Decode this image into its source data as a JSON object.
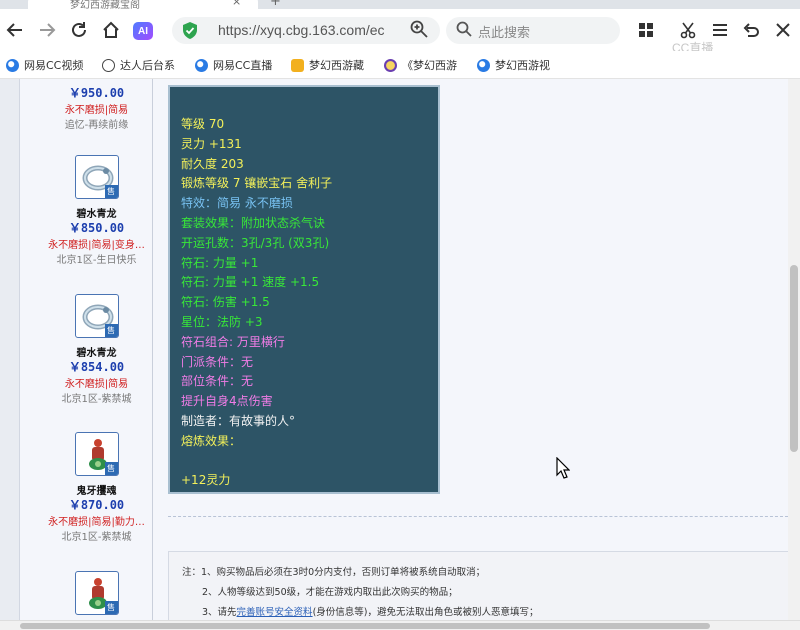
{
  "browser": {
    "tab_title": "梦幻西游藏宝阁",
    "tab_close_glyph": "×",
    "new_tab_glyph": "+",
    "url": "https://xyq.cbg.163.com/ec",
    "search_placeholder": "点此搜索",
    "ai_label": "AI",
    "watermark": "CC直播"
  },
  "bookmarks": [
    {
      "label": "网易CC视频",
      "icon": "cc-icon"
    },
    {
      "label": "达人后台系",
      "icon": "globe-icon"
    },
    {
      "label": "网易CC直播",
      "icon": "cc-icon"
    },
    {
      "label": "梦幻西游藏",
      "icon": "star-icon"
    },
    {
      "label": "《梦幻西游",
      "icon": "gold-icon"
    },
    {
      "label": "梦幻西游视",
      "icon": "cc-icon"
    }
  ],
  "listing": {
    "top_item": {
      "price": "￥950.00",
      "tags": "永不磨损|简易",
      "server": "追忆-再续前缘"
    },
    "items": [
      {
        "name": "碧水青龙",
        "price": "￥850.00",
        "tags": "永不磨损|简易|变身…",
        "server": "北京1区-生日快乐",
        "icon": "jade-dragon-icon",
        "badge": "售"
      },
      {
        "name": "碧水青龙",
        "price": "￥854.00",
        "tags": "永不磨损|简易",
        "server": "北京1区-紫禁城",
        "icon": "jade-dragon-icon",
        "badge": "售"
      },
      {
        "name": "鬼牙攫魂",
        "price": "￥870.00",
        "tags": "永不磨损|简易|勤力…",
        "server": "北京1区-紫禁城",
        "icon": "ghost-fang-icon",
        "badge": "售"
      },
      {
        "name": "",
        "price": "",
        "tags": "",
        "server": "",
        "icon": "ghost-fang-icon",
        "badge": "售"
      }
    ]
  },
  "detail": {
    "lines": [
      {
        "text": "等级 70",
        "color": "#f3f05a"
      },
      {
        "text": "灵力 +131",
        "color": "#f3f05a"
      },
      {
        "text": "耐久度 203",
        "color": "#f3f05a"
      },
      {
        "text": "锻炼等级 7 镶嵌宝石 舍利子",
        "color": "#f3f05a"
      },
      {
        "text": "特效：简易 永不磨损",
        "color": "#78c2f2"
      },
      {
        "text": "套装效果：附加状态杀气诀",
        "color": "#38e838"
      },
      {
        "text": "开运孔数：3孔/3孔 (双3孔)",
        "color": "#38e838"
      },
      {
        "text": "符石: 力量 +1",
        "color": "#38e838"
      },
      {
        "text": "符石: 力量 +1 速度 +1.5",
        "color": "#38e838"
      },
      {
        "text": "符石: 伤害 +1.5",
        "color": "#38e838"
      },
      {
        "text": "星位：法防 +3",
        "color": "#38e838"
      },
      {
        "text": "符石组合: 万里横行",
        "color": "#f07ce6"
      },
      {
        "text": "门派条件：无",
        "color": "#f07ce6"
      },
      {
        "text": "部位条件：无",
        "color": "#f07ce6"
      },
      {
        "text": "提升自身4点伤害",
        "color": "#f07ce6"
      },
      {
        "text": "制造者：有故事的人°",
        "color": "#f2f2f2"
      },
      {
        "text": "熔炼效果：",
        "color": "#f3f05a"
      },
      {
        "text": "",
        "color": "#f3f05a"
      },
      {
        "text": "+12灵力",
        "color": "#f3f05a"
      }
    ]
  },
  "notes": {
    "line1": "注：1、购买物品后必须在3时0分内支付，否则订单将被系统自动取消；",
    "line2": "2、人物等级达到50级，才能在游戏内取出此次购买的物品；",
    "line3_prefix": "3、请先",
    "line3_link": "完善账号安全资料",
    "line3_suffix": "(身份信息等)，避免无法取出角色或被别人恶意填写；"
  }
}
